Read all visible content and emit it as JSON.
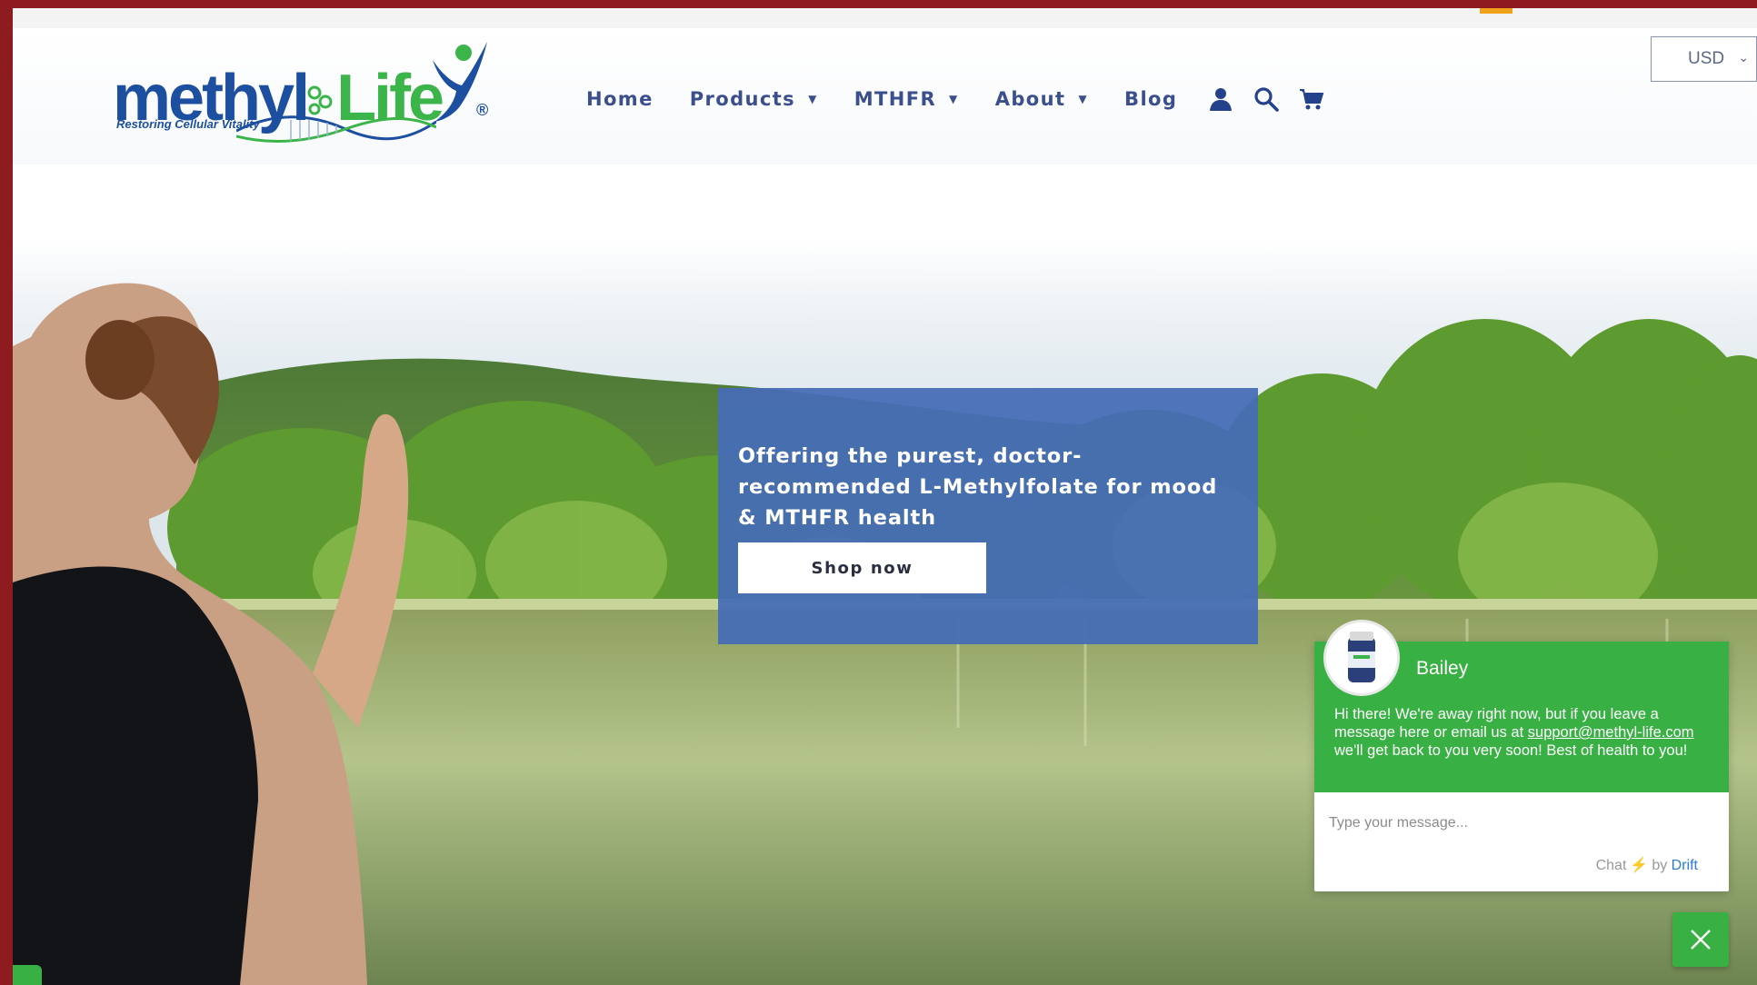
{
  "brand": {
    "logo_part1": "methyl",
    "logo_part2": "Life",
    "reg_mark": "®",
    "tagline": "Restoring Cellular Vitality"
  },
  "nav": {
    "items": [
      {
        "label": "Home",
        "has_dropdown": false
      },
      {
        "label": "Products",
        "has_dropdown": true
      },
      {
        "label": "MTHFR",
        "has_dropdown": true
      },
      {
        "label": "About",
        "has_dropdown": true
      },
      {
        "label": "Blog",
        "has_dropdown": false
      }
    ],
    "icons": [
      "account-icon",
      "search-icon",
      "cart-icon"
    ],
    "currency": "USD"
  },
  "hero": {
    "headline": "Offering the purest, doctor-recommended L-Methylfolate for mood & MTHFR health",
    "cta_label": "Shop now"
  },
  "chat": {
    "agent_name": "Bailey",
    "message_before_link": "Hi there! We're away right now, but if you leave a message here or email us at ",
    "email_link": "support@methyl-life.com",
    "message_after_link": " we'll get back to you very soon! Best of health to you!",
    "input_placeholder": "Type your message...",
    "brand_prefix": "Chat",
    "brand_by": "by",
    "brand_name": "Drift"
  },
  "colors": {
    "nav_text": "#3a4f8c",
    "brand_blue": "#1d4fa0",
    "brand_green": "#3bb54a",
    "promo_bg": "#466cb7",
    "chat_green": "#38b043",
    "frame_red": "#8e1b1f"
  }
}
